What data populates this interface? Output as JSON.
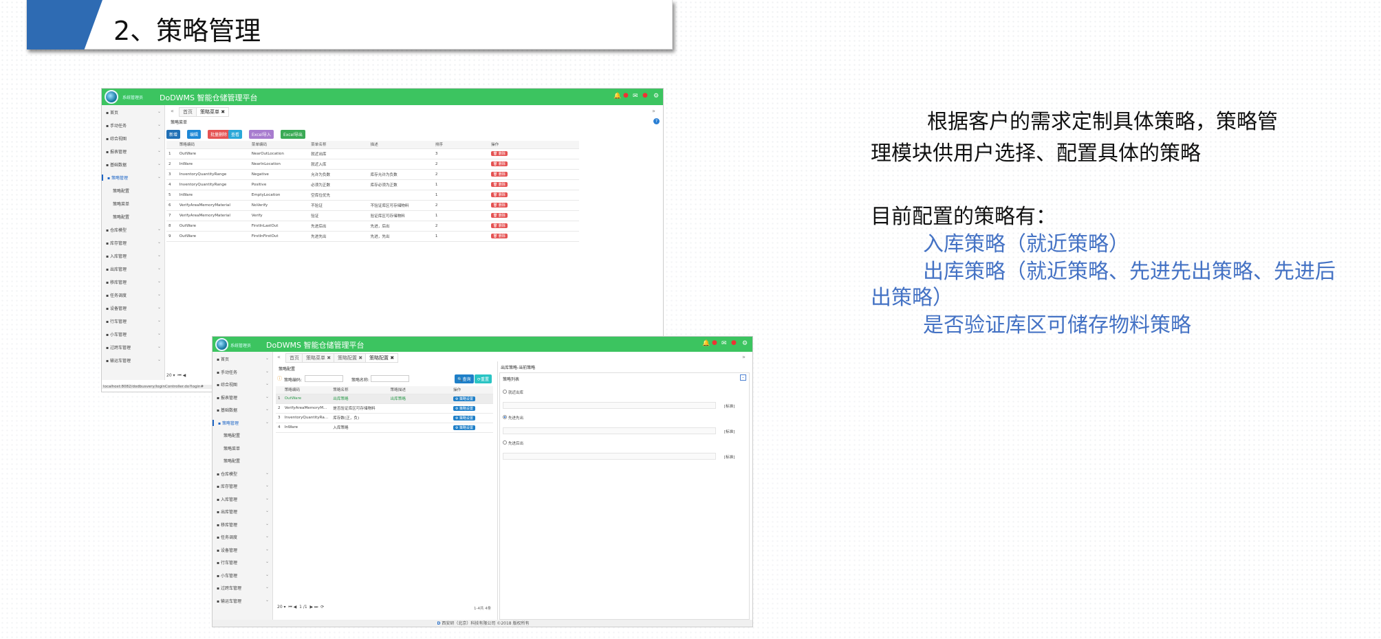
{
  "slide_title": "2、策略管理",
  "description": {
    "line1": "根据客户的需求定制具体策略，策略管",
    "line2": "理模块供用户选择、配置具体的策略",
    "line3": "目前配置的策略有：",
    "item1": "入库策略（就近策略）",
    "item2": "出库策略（就近策略、先进先出策略、先进后",
    "item2b": "出策略）",
    "item3": "是否验证库区可储存物料策略"
  },
  "app": {
    "title": "DoDWMS 智能仓储管理平台",
    "user_label": "系统管理员"
  },
  "shot1": {
    "sidebar": [
      {
        "label": "首页",
        "icon": "home-icon"
      },
      {
        "label": "手动任务",
        "icon": "hand-icon"
      },
      {
        "label": "综合视图",
        "icon": "view-icon"
      },
      {
        "label": "报表管理",
        "icon": "report-icon"
      },
      {
        "label": "基础数据",
        "icon": "data-icon"
      },
      {
        "label": "策略管理",
        "icon": "strategy-icon"
      },
      {
        "label": "策略配置",
        "icon": ""
      },
      {
        "label": "策略菜单",
        "icon": ""
      },
      {
        "label": "策略配置",
        "icon": ""
      },
      {
        "label": "仓库模型",
        "icon": "model-icon"
      },
      {
        "label": "库存管理",
        "icon": "stock-icon"
      },
      {
        "label": "入库管理",
        "icon": "inbound-icon"
      },
      {
        "label": "出库管理",
        "icon": "outbound-icon"
      },
      {
        "label": "移库管理",
        "icon": "move-icon"
      },
      {
        "label": "任务调度",
        "icon": "task-icon"
      },
      {
        "label": "设备管理",
        "icon": "device-icon"
      },
      {
        "label": "行车管理",
        "icon": "crane-icon"
      },
      {
        "label": "小车管理",
        "icon": "car-icon"
      },
      {
        "label": "过跨车管理",
        "icon": "cross-icon"
      },
      {
        "label": "输运车管理",
        "icon": "transport-icon"
      }
    ],
    "tabs": [
      "首页",
      "策略菜单"
    ],
    "panel_title": "策略菜单",
    "buttons": [
      {
        "label": "新增",
        "color": "#1f6fb5"
      },
      {
        "label": "编辑",
        "color": "#1e88d6"
      },
      {
        "label": "批量删除",
        "color": "#e55353"
      },
      {
        "label": "查看",
        "color": "#2aa8d8"
      },
      {
        "label": "Excel导入",
        "color": "#a87ccf"
      },
      {
        "label": "Excel导出",
        "color": "#3aaa55"
      }
    ],
    "columns": [
      "",
      "策略编码",
      "菜单编码",
      "菜单名称",
      "描述",
      "排序",
      "操作"
    ],
    "rows": [
      [
        "1",
        "OutWare",
        "NearOutLocation",
        "就近出库",
        "",
        "3",
        "删除"
      ],
      [
        "2",
        "InWare",
        "NearInLocation",
        "就近入库",
        "",
        "2",
        "删除"
      ],
      [
        "3",
        "InventoryQuantityRange",
        "Negative",
        "允许为负数",
        "库存允许为负数",
        "2",
        "删除"
      ],
      [
        "4",
        "InventoryQuantityRange",
        "Positive",
        "必须为正数",
        "库存必须为正数",
        "1",
        "删除"
      ],
      [
        "5",
        "InWare",
        "EmptyLocation",
        "空库位优先",
        "",
        "1",
        "删除"
      ],
      [
        "6",
        "VerifyAreaMemoryMaterial",
        "NoVerify",
        "不验证",
        "不验证库区可存储物料",
        "2",
        "删除"
      ],
      [
        "7",
        "VerifyAreaMemoryMaterial",
        "Verify",
        "验证",
        "验证库区可存储物料",
        "1",
        "删除"
      ],
      [
        "8",
        "OutWare",
        "FirstInLastOut",
        "先进后出",
        "先进，后出",
        "2",
        "删除"
      ],
      [
        "9",
        "OutWare",
        "FirstInFirstOut",
        "先进先出",
        "先进，先出",
        "1",
        "删除"
      ]
    ],
    "pager_size": "20",
    "status_url": "localhost:8082/dodbusvery/loginController.do?login#"
  },
  "shot2": {
    "sidebar": [
      {
        "label": "首页"
      },
      {
        "label": "手动任务"
      },
      {
        "label": "综合视图"
      },
      {
        "label": "报表管理"
      },
      {
        "label": "基础数据"
      },
      {
        "label": "策略管理"
      },
      {
        "label": "策略配置"
      },
      {
        "label": "策略菜单"
      },
      {
        "label": "策略配置"
      },
      {
        "label": "仓库模型"
      },
      {
        "label": "库存管理"
      },
      {
        "label": "入库管理"
      },
      {
        "label": "出库管理"
      },
      {
        "label": "移库管理"
      },
      {
        "label": "任务调度"
      },
      {
        "label": "设备管理"
      },
      {
        "label": "行车管理"
      },
      {
        "label": "小车管理"
      },
      {
        "label": "过跨车管理"
      },
      {
        "label": "输运车管理"
      }
    ],
    "tabs": [
      "首页",
      "策略菜单",
      "策略配置",
      "策略配置"
    ],
    "panel_title": "策略配置",
    "search": {
      "code_label": "策略编码:",
      "name_label": "策略名称:",
      "query_button": "查询",
      "reset_button": "重置"
    },
    "columns": [
      "",
      "策略编码",
      "策略名称",
      "策略描述",
      "操作"
    ],
    "rows": [
      [
        "1",
        "OutWare",
        "出库策略",
        "出库策略",
        "策略设置"
      ],
      [
        "2",
        "VerifyAreaMemoryM...",
        "是否验证库区可存储物料",
        "",
        "策略设置"
      ],
      [
        "3",
        "InventoryQuantityRa...",
        "库存数(正，负)",
        "",
        "策略设置"
      ],
      [
        "4",
        "InWare",
        "入库策略",
        "",
        "策略设置"
      ]
    ],
    "right_header": "出库策略-当前策略",
    "right_panel": "策略列表",
    "options": [
      {
        "label": "就近出库",
        "tag": "[标准]",
        "checked": false
      },
      {
        "label": "先进先出",
        "tag": "[标准]",
        "checked": true
      },
      {
        "label": "先进后出",
        "tag": "[标准]",
        "checked": false
      }
    ],
    "pager_size": "20",
    "pager_page": "1",
    "pager_total": "/1",
    "pager_info": "1-4共 4条",
    "footer": "西安研（北京）科技有限公司 ©2018 版权所有"
  }
}
